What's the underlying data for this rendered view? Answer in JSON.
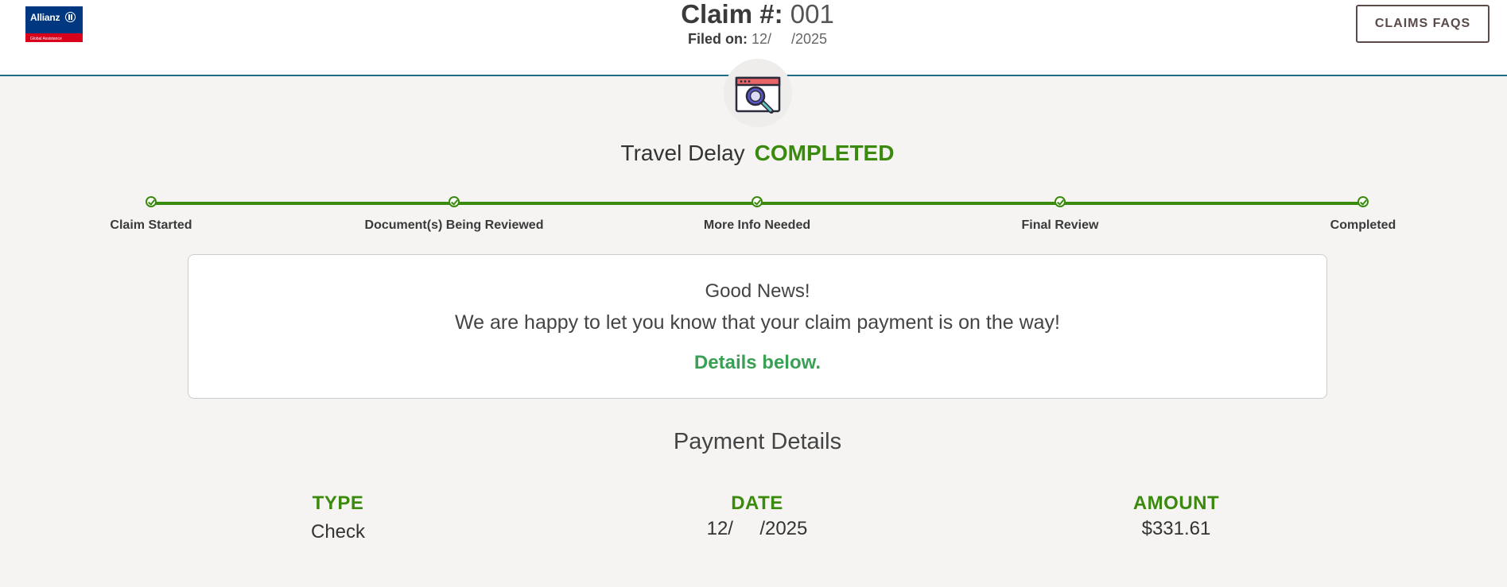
{
  "header": {
    "logo": {
      "word": "Allianz",
      "sub": "Global Assistance"
    },
    "claim_label": "Claim #:",
    "claim_number": "001",
    "filed_label": "Filed on:",
    "filed_value": "12/     /2025",
    "faq_button": "CLAIMS FAQS"
  },
  "status": {
    "claim_type": "Travel Delay",
    "state": "COMPLETED"
  },
  "progress": {
    "steps": [
      {
        "label": "Claim Started",
        "done": true
      },
      {
        "label": "Document(s) Being Reviewed",
        "done": true
      },
      {
        "label": "More Info Needed",
        "done": true
      },
      {
        "label": "Final Review",
        "done": true
      },
      {
        "label": "Completed",
        "done": true
      }
    ]
  },
  "message": {
    "headline": "Good News!",
    "body": "We are happy to let you know that your claim payment is on the way!",
    "details": "Details below."
  },
  "payment": {
    "title": "Payment Details",
    "type_label": "TYPE",
    "type_value": "Check",
    "date_label": "DATE",
    "date_value": "12/     /2025",
    "amount_label": "AMOUNT",
    "amount_value": "$331.61"
  },
  "colors": {
    "brand_blue": "#003781",
    "brand_red": "#d9001b",
    "success_green": "#3a8a0e",
    "details_green": "#3aa055",
    "header_rule": "#1f6b8a"
  },
  "icons": {
    "hero": "browser-magnifier-icon",
    "step_marker": "check-circle-icon"
  }
}
